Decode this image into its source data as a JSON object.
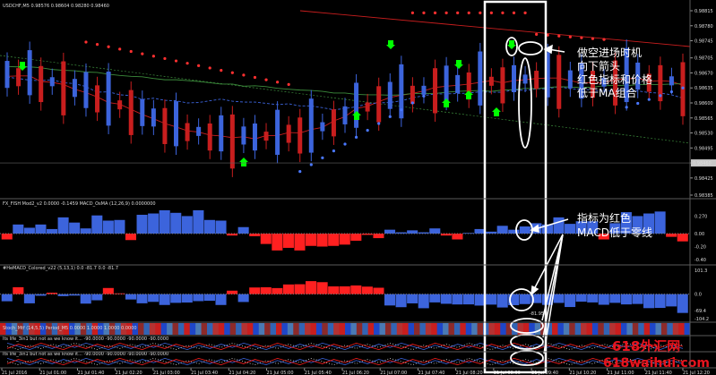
{
  "chart_data": [
    {
      "type": "candlestick",
      "title": "USDCHF,M5  0.98576 0.98604 0.98280 0.98460",
      "y_ticks": [
        "0.98815",
        "0.98780",
        "0.98745",
        "0.98705",
        "0.98670",
        "0.98635",
        "0.98600",
        "0.98565",
        "0.98530",
        "0.98495",
        "0.98460",
        "0.98425",
        "0.98385"
      ],
      "ylim": [
        0.98385,
        0.98815
      ],
      "price_tag": "0.98460",
      "series": [
        {
          "name": "",
          "color": "#c81e1e",
          "x": [
            0,
            10,
            20,
            30,
            40,
            50,
            60,
            70,
            80,
            90,
            100,
            110,
            120,
            130,
            140,
            150,
            160,
            170,
            180,
            190,
            200,
            210,
            220,
            230,
            240,
            250,
            260,
            270,
            280,
            290,
            300,
            310,
            320,
            330,
            340,
            350,
            360,
            370,
            380,
            390,
            400,
            410,
            420,
            430,
            440,
            450,
            460,
            470,
            480,
            490,
            500,
            510,
            520,
            530,
            540,
            550,
            560,
            570,
            580,
            590,
            600
          ],
          "y": [
            0.98662,
            0.98663,
            0.98663,
            0.9865,
            0.98648,
            0.98643,
            0.98632,
            0.98624,
            0.98614,
            0.98601,
            0.98597,
            0.98585,
            0.98573,
            0.98563,
            0.98552,
            0.98544,
            0.98535,
            0.98532,
            0.98525,
            0.98523,
            0.98519,
            0.98521,
            0.98516,
            0.98524,
            0.98524,
            0.98531,
            0.9853,
            0.98538,
            0.98543,
            0.98558,
            0.98568,
            0.98587,
            0.98592,
            0.98603,
            0.98613,
            0.98618,
            0.98622,
            0.98628,
            0.98636,
            0.98639,
            0.98641,
            0.98644,
            0.98648,
            0.98652,
            0.98647,
            0.98652,
            0.98654,
            0.98657,
            0.98658,
            0.98658,
            0.98652,
            0.98646,
            0.98648,
            0.98647,
            0.98654,
            0.98656,
            0.98658,
            0.9865,
            0.98652,
            0.9865,
            0.98641
          ]
        },
        {
          "name": "",
          "color": "#3c64dc",
          "x": [
            0,
            10,
            20,
            30,
            40,
            50,
            60,
            70,
            80,
            90,
            100,
            110,
            120,
            130,
            140,
            150,
            160,
            170,
            180,
            190,
            200,
            210,
            220,
            230,
            240,
            250,
            260,
            270,
            280,
            290,
            300,
            310,
            320,
            330,
            340,
            350,
            360,
            370,
            380,
            390,
            400,
            410,
            420,
            430,
            440,
            450,
            460,
            470,
            480,
            490,
            500,
            510,
            520,
            530,
            540,
            550,
            560,
            570,
            580,
            590,
            600
          ],
          "y": [
            0.9866,
            0.98657,
            0.98653,
            0.98652,
            0.98654,
            0.98647,
            0.98645,
            0.98638,
            0.98625,
            0.98626,
            0.98619,
            0.98617,
            0.98608,
            0.98611,
            0.98606,
            0.98605,
            0.986,
            0.98601,
            0.98605,
            0.98609,
            0.98604,
            0.98602,
            0.98602,
            0.98599,
            0.98596,
            0.98598,
            0.98593,
            0.98593,
            0.98589,
            0.98584,
            0.98587,
            0.98591,
            0.98598,
            0.986,
            0.98601,
            0.98605,
            0.98612,
            0.98617,
            0.98621,
            0.98621,
            0.98622,
            0.98623,
            0.98626,
            0.98625,
            0.98625,
            0.98631,
            0.98629,
            0.98633,
            0.98633,
            0.98638,
            0.98633,
            0.98632,
            0.9863,
            0.98627,
            0.98629,
            0.9863,
            0.98628,
            0.98624,
            0.98623,
            0.98619,
            0.98611
          ]
        },
        {
          "name": "",
          "color": "#3c8c3c",
          "x": [
            0,
            10,
            20,
            30,
            40,
            50,
            60,
            70,
            80,
            90,
            100,
            110,
            120,
            130,
            140,
            150,
            160,
            170,
            180,
            190,
            200,
            210,
            220,
            230,
            240,
            250,
            260,
            270,
            280,
            290,
            300,
            310,
            320,
            330,
            340,
            350,
            360,
            370,
            380,
            390,
            400,
            410,
            420,
            430,
            440,
            450,
            460,
            470,
            480,
            490,
            500,
            510,
            520,
            530,
            540,
            550,
            560,
            570,
            580,
            590,
            600
          ],
          "y": [
            0.98685,
            0.98684,
            0.98684,
            0.98682,
            0.98678,
            0.98676,
            0.98675,
            0.98672,
            0.98671,
            0.98667,
            0.98664,
            0.98662,
            0.98661,
            0.98657,
            0.98654,
            0.98654,
            0.98652,
            0.9865,
            0.98647,
            0.98644,
            0.98644,
            0.98639,
            0.9864,
            0.98638,
            0.98634,
            0.98632,
            0.9863,
            0.98629,
            0.98627,
            0.98623,
            0.98623,
            0.9862,
            0.98619,
            0.98619,
            0.98618,
            0.98619,
            0.98622,
            0.98622,
            0.98622,
            0.98625,
            0.98627,
            0.98628,
            0.98629,
            0.98627,
            0.9863,
            0.98631,
            0.98634,
            0.98633,
            0.98636,
            0.98638,
            0.98637,
            0.98636,
            0.98637,
            0.9864,
            0.98641,
            0.9864,
            0.98643,
            0.98643,
            0.98643,
            0.98644,
            0.98645
          ]
        }
      ],
      "sell_signals": [
        "1",
        "40",
        "125",
        "160",
        "262",
        "350",
        "447",
        "506",
        "514",
        "517",
        "525"
      ],
      "buy_signals": [
        "0",
        "60",
        "130",
        "180",
        "262",
        "350",
        "400",
        "442",
        "470",
        "499",
        "504",
        "508",
        "515",
        "521",
        "524",
        "530",
        "535",
        "539"
      ],
      "annotation": "做空进场时机\n向下箭头\n红色指标和价格\n低于MA组合"
    },
    {
      "type": "bar",
      "title": "FX_FISH Mod2_v2 0.0000 -0.1459  MACD_OsMA (12,26,9) 0.0000000",
      "y_ticks": [
        "0.270",
        "0.00",
        "-0.20",
        "-0.40"
      ],
      "values": [
        -0.09,
        0.14,
        0.09,
        0.14,
        0.07,
        0.25,
        0.17,
        0.08,
        0.28,
        0.2,
        0.21,
        -0.1,
        0.29,
        0.31,
        0.36,
        0.32,
        0.27,
        0.36,
        0.21,
        0.2,
        -0.03,
        0.1,
        -0.04,
        -0.16,
        -0.26,
        -0.22,
        -0.26,
        -0.19,
        -0.2,
        -0.19,
        -0.17,
        -0.11,
        -0.02,
        -0.07,
        0.06,
        0.02,
        0.05,
        0.02,
        0.08,
        -0.03,
        -0.09,
        0.01,
        0.07,
        0.03,
        0.12,
        0.06,
        0.11,
        0.16,
        0.14,
        0.25,
        0.15,
        0.19,
        0.19,
        -0.09,
        0.16,
        0.33,
        0.27,
        0.31,
        0.34,
        -0.05,
        -0.12
      ],
      "annotation": "指标为红色\nMACD低于零线"
    },
    {
      "type": "bar",
      "title": "#HeMACD_Colored_v22 (5,13,1) 0.0 -81.7 0.0 -81.7",
      "y_ticks": [
        "101.3",
        "0.0",
        "-69.4",
        "-104.2"
      ],
      "value_tag": "-81.95",
      "values": [
        -30.4,
        29.3,
        -39.2,
        -7.0,
        5.9,
        -8.6,
        -6.3,
        -40.5,
        -26.3,
        26.0,
        3.3,
        -22.9,
        -39.1,
        -33.0,
        -46.2,
        -37.2,
        -35.8,
        -29.9,
        -28.3,
        -46.3,
        14.6,
        -33.6,
        28.2,
        29.1,
        25.6,
        41.0,
        42.0,
        55.2,
        50.8,
        32.9,
        33.0,
        36.8,
        31.9,
        27.1,
        -48.4,
        -55.6,
        -39.4,
        -60.1,
        -35.3,
        -41.2,
        -44.0,
        -43.7,
        -48.8,
        -44.7,
        -56.9,
        -47.0,
        -42.4,
        -38.1,
        -45.9,
        -37.5,
        -54.9,
        -32.2,
        -35.4,
        -45.3,
        -37.2,
        -43.8,
        -41.9,
        -59.7,
        -58.7,
        -52.4,
        -80.1
      ]
    },
    {
      "type": "heatmap",
      "title": "Stoch_Mtf (14,5,5) Period_M5 0.0000 1.0000 1.0000 0.0000"
    },
    {
      "type": "line",
      "title": "Its life_3in1 but not as we know it...  -90.0000  -90.0000  -90.0000  -90.0000"
    },
    {
      "type": "line",
      "title": "Its life_3in1 but not as we know it...  -90.0000  -90.0000  -90.0000  -90.0000"
    }
  ],
  "x_ticks": [
    "21 Jul 2016",
    "21 Jul 01:00",
    "21 Jul 01:40",
    "21 Jul 02:20",
    "21 Jul 03:00",
    "21 Jul 03:40",
    "21 Jul 04:20",
    "21 Jul 05:00",
    "21 Jul 05:40",
    "21 Jul 06:20",
    "21 Jul 07:00",
    "21 Jul 07:40",
    "21 Jul 08:20",
    "21 Jul 09:00",
    "21 Jul 09:40",
    "21 Jul 10:20",
    "21 Jul 11:00",
    "21 Jul 11:40",
    "21 Jul 12:20"
  ],
  "watermark": {
    "line1": "618外汇网",
    "line2": "618waihui.com"
  },
  "colors": {
    "up_candle": "#3c64dc",
    "down_candle": "#c81e1e",
    "highlight_box": "#ffffff",
    "sell_arrow": "#ff0000",
    "buy_arrow": "#00ff00",
    "watermark": "#e8141e"
  }
}
